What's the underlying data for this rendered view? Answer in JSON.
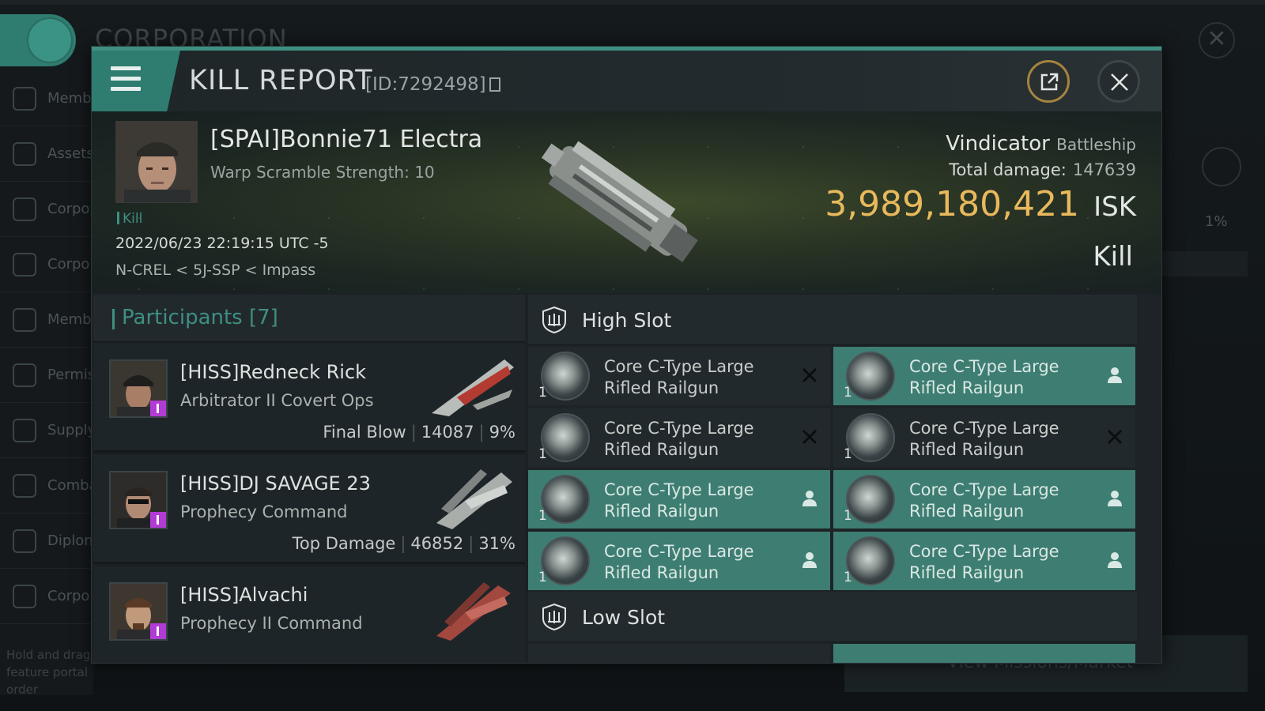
{
  "background": {
    "title": "CORPORATION",
    "sidebar_items": [
      "Members",
      "Assets",
      "Corporation",
      "Corporation",
      "Member Applications",
      "Permissions Management",
      "Supply",
      "Combat",
      "Diplomacy",
      "Corporation"
    ],
    "hint": "Hold and drag feature portal order",
    "right_pct": "1%",
    "right_button": "View Missions/Market"
  },
  "header": {
    "title": "KILL REPORT",
    "id_text": "[ID:7292498]"
  },
  "hero": {
    "pilot_name": "[SPAI]Bonnie71 Electra",
    "warp_scramble": "Warp Scramble Strength: 10",
    "kill_tag": "Kill",
    "timestamp": "2022/06/23 22:19:15 UTC -5",
    "location": "N-CREL < 5J-SSP < Impass",
    "ship_name": "Vindicator",
    "ship_class": "Battleship",
    "total_damage_label": "Total damage:",
    "total_damage_value": "147639",
    "isk_value": "3,989,180,421",
    "isk_unit": "ISK",
    "outcome": "Kill"
  },
  "participants": {
    "header": "Participants [7]",
    "rows": [
      {
        "name": "[HISS]Redneck Rick",
        "ship": "Arbitrator II Covert Ops",
        "role": "Final Blow",
        "damage": "14087",
        "percent": "9%"
      },
      {
        "name": "[HISS]DJ SAVAGE 23",
        "ship": "Prophecy Command",
        "role": "Top Damage",
        "damage": "46852",
        "percent": "31%"
      },
      {
        "name": "[HISS]Alvachi",
        "ship": "Prophecy II Command",
        "role": "",
        "damage": "",
        "percent": ""
      }
    ]
  },
  "slots": {
    "high_slot_label": "High Slot",
    "low_slot_label": "Low Slot",
    "high_modules": [
      {
        "name": "Core C-Type Large Rifled Railgun",
        "qty": "1",
        "status": "destroyed",
        "status_icon": "x-icon"
      },
      {
        "name": "Core C-Type Large Rifled Railgun",
        "qty": "1",
        "status": "dropped",
        "status_icon": "person-icon"
      },
      {
        "name": "Core C-Type Large Rifled Railgun",
        "qty": "1",
        "status": "destroyed",
        "status_icon": "x-icon"
      },
      {
        "name": "Core C-Type Large Rifled Railgun",
        "qty": "1",
        "status": "destroyed",
        "status_icon": "x-icon"
      },
      {
        "name": "Core C-Type Large Rifled Railgun",
        "qty": "1",
        "status": "dropped",
        "status_icon": "person-icon"
      },
      {
        "name": "Core C-Type Large Rifled Railgun",
        "qty": "1",
        "status": "dropped",
        "status_icon": "person-icon"
      },
      {
        "name": "Core C-Type Large Rifled Railgun",
        "qty": "1",
        "status": "dropped",
        "status_icon": "person-icon"
      },
      {
        "name": "Core C-Type Large Rifled Railgun",
        "qty": "1",
        "status": "dropped",
        "status_icon": "person-icon"
      }
    ]
  },
  "colors": {
    "accent_teal": "#3e8f82",
    "isk_gold": "#e8b95c",
    "fitted_row": "#3e7d72",
    "pilot_badge": "#b23bd6"
  }
}
